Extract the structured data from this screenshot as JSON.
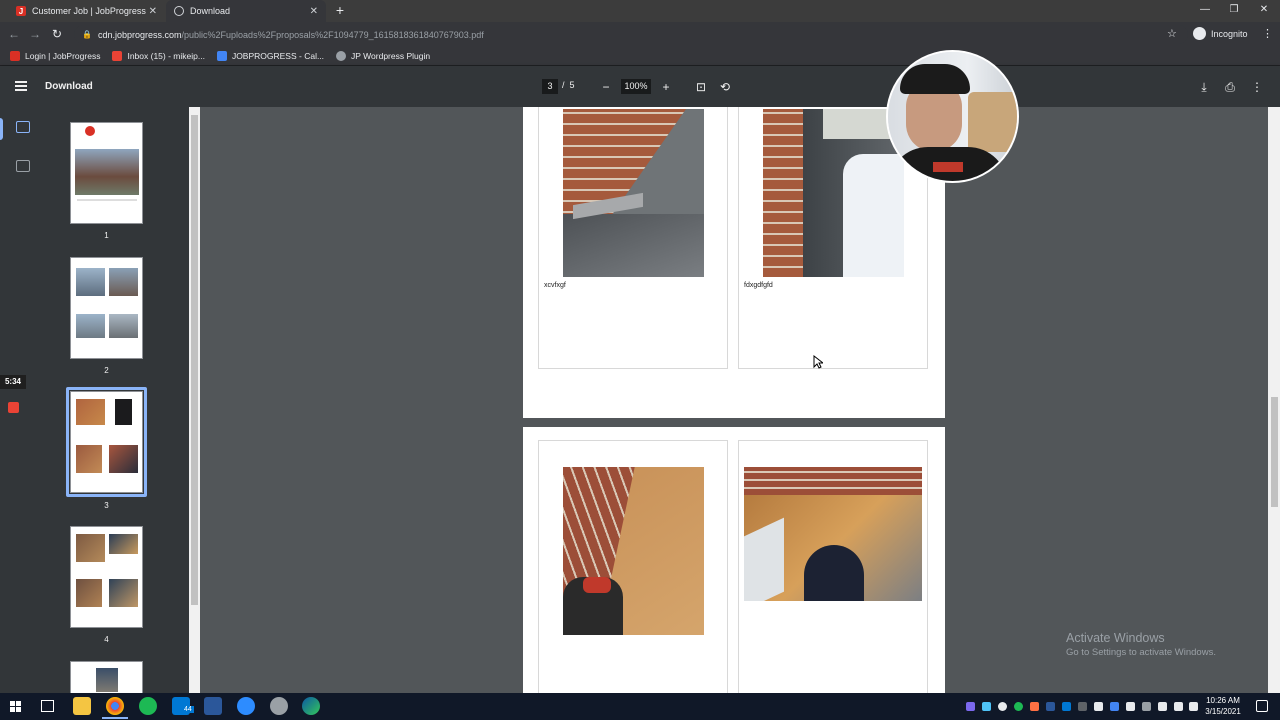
{
  "browser": {
    "tabs": [
      {
        "title": "Customer Job | JobProgress",
        "active": false,
        "favicon_color": "#d93025"
      },
      {
        "title": "Download",
        "active": true,
        "favicon_color": "#5f6368"
      }
    ],
    "address": {
      "host": "cdn.jobprogress.com",
      "path": "/public%2Fuploads%2Fproposals%2F1094779_1615818361840767903.pdf"
    },
    "profile_label": "Incognito",
    "bookmarks": [
      {
        "label": "Login | JobProgress",
        "icon": "jobprogress-icon",
        "color": "#d93025"
      },
      {
        "label": "Inbox (15) - mikeip...",
        "icon": "gmail-icon",
        "color": "#ea4335"
      },
      {
        "label": "JOBPROGRESS - Cal...",
        "icon": "calendar-icon",
        "color": "#4285f4"
      },
      {
        "label": "JP Wordpress Plugin",
        "icon": "wordpress-icon",
        "color": "#9aa0a6"
      }
    ]
  },
  "pdf_viewer": {
    "doc_title": "Download",
    "current_page": "3",
    "page_separator": "/",
    "total_pages": "5",
    "zoom": "100%",
    "thumbnails": [
      "1",
      "2",
      "3",
      "4"
    ],
    "selected_thumbnail": "3",
    "recording_time": "5:34"
  },
  "page_content": {
    "captions": [
      "xcvfxgf",
      "fdxgdfgfd"
    ]
  },
  "watermark": {
    "line1": "Activate Windows",
    "line2": "Go to Settings to activate Windows."
  },
  "taskbar": {
    "time": "10:26 AM",
    "date": "3/15/2021",
    "mail_badge": "44"
  }
}
